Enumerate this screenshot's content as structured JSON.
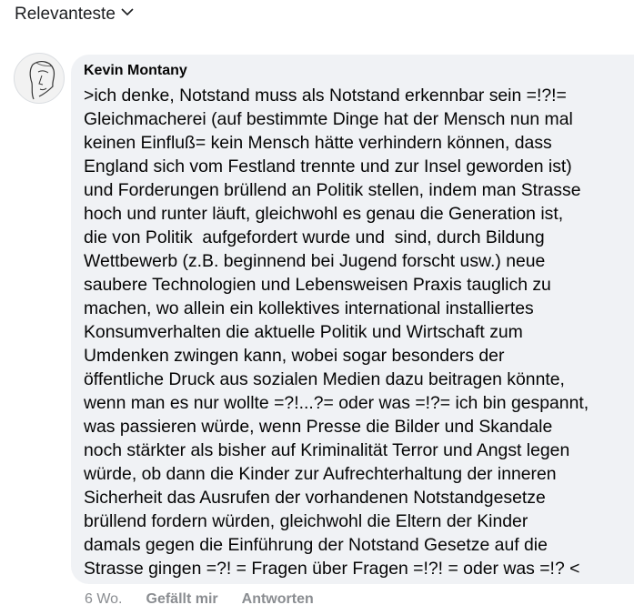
{
  "sort": {
    "label": "Relevanteste",
    "icon": "chevron-down-icon"
  },
  "comment": {
    "avatar_icon": "sketch-face-avatar",
    "author": "Kevin Montany",
    "text": ">ich denke, Notstand muss als Notstand erkennbar sein =!?!=\nGleichmacherei (auf bestimmte Dinge hat der Mensch nun mal\nkeinen Einfluß= kein Mensch hätte verhindern können, dass\nEngland sich vom Festland trennte und zur Insel geworden ist)\nund Forderungen brüllend an Politik stellen, indem man Strasse\nhoch und runter läuft, gleichwohl es genau die Generation ist,\ndie von Politik  aufgefordert wurde und  sind, durch Bildung\nWettbewerb (z.B. beginnend bei Jugend forscht usw.) neue\nsaubere Technologien und Lebensweisen Praxis tauglich zu\nmachen, wo allein ein kollektives international installiertes\nKonsumverhalten die aktuelle Politik und Wirtschaft zum\nUmdenken zwingen kann, wobei sogar besonders der\nöffentliche Druck aus sozialen Medien dazu beitragen könnte,\nwenn man es nur wollte =?!...?= oder was =!?= ich bin gespannt,\nwas passieren würde, wenn Presse die Bilder und Skandale\nnoch stärkter als bisher auf Kriminalität Terror und Angst legen\nwürde, ob dann die Kinder zur Aufrechterhaltung der inneren\nSicherheit das Ausrufen der vorhandenen Notstandgesetze\nbrüllend fordern würden, gleichwohl die Eltern der Kinder\ndamals gegen die Einführung der Notstand Gesetze auf die\nStrasse gingen =?! = Fragen über Fragen =!?! = oder was =!? <",
    "timestamp": "6 Wo.",
    "like_label": "Gefällt mir",
    "reply_label": "Antworten"
  },
  "colors": {
    "bubble": "#f0f2f5",
    "meta_text": "#8a8d91",
    "text": "#050505"
  }
}
